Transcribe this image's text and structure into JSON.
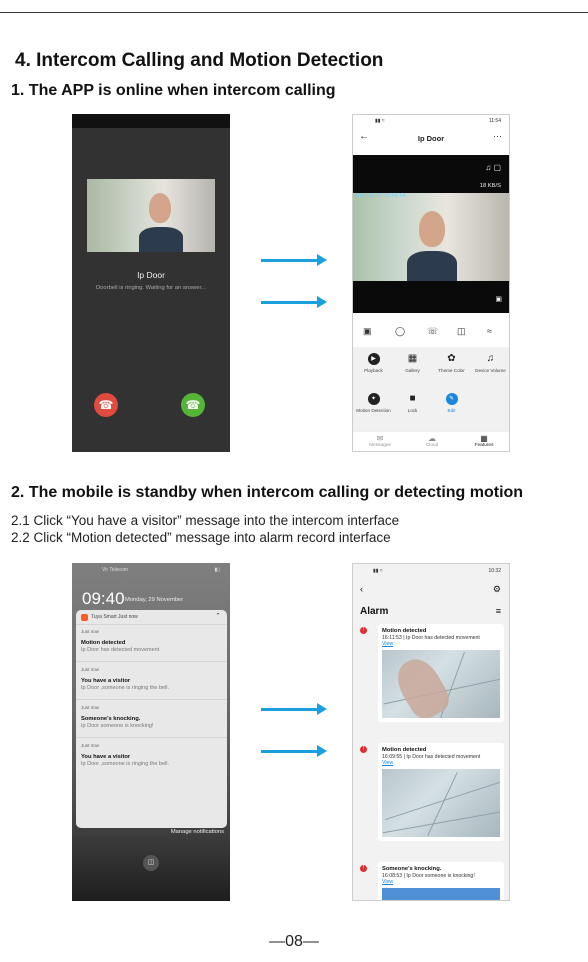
{
  "section_title": "4. Intercom Calling and Motion Detection",
  "sub1": "1. The APP is online when intercom calling",
  "sub2": "2. The mobile is standby when intercom calling or detecting motion",
  "step1": "2.1 Click “You have a visitor” message into the intercom interface",
  "step2": "2.2 Click “Motion detected” message into alarm record interface",
  "page_number": "—08—",
  "accent_color": "#1aa0dd",
  "call_screen": {
    "device_name": "Ip Door",
    "status": "Doorbell is ringing. Waiting for an answer..."
  },
  "live_view": {
    "status_time": "11:54",
    "title": "Ip Door",
    "more": "···",
    "rate": "18 KB/S",
    "timestamp": "2021-11-27 11:54:14",
    "features": [
      {
        "label": "Playback",
        "icon": "play-icon"
      },
      {
        "label": "Gallery",
        "icon": "gallery-icon"
      },
      {
        "label": "Theme Color",
        "icon": "palette-icon"
      },
      {
        "label": "Device Volume",
        "icon": "speaker-icon"
      },
      {
        "label": "Motion Detection",
        "icon": "motion-icon"
      },
      {
        "label": "Lock",
        "icon": "lock-icon"
      },
      {
        "label": "Edit",
        "icon": "edit-icon"
      }
    ],
    "tabs": [
      "Messages",
      "Cloud",
      "Features"
    ]
  },
  "lock_screen": {
    "carrier": "Vir Telecom",
    "time": "09:40",
    "date": "Monday, 29 November",
    "app": "Tuya Smart",
    "app_time": "Just now",
    "notifications": [
      {
        "time": "Just now",
        "title": "Motion detected",
        "body": "Ip Door has detected movement"
      },
      {
        "time": "Just now",
        "title": "You have a visitor",
        "body": "Ip Door ,someone is ringing the bell."
      },
      {
        "time": "Just now",
        "title": "Someone's knocking.",
        "body": "Ip Door someone is knocking!"
      },
      {
        "time": "Just now",
        "title": "You have a visitor",
        "body": "Ip Door ,someone is ringing the bell."
      }
    ],
    "manage": "Manage notifications"
  },
  "alarm_screen": {
    "status_time": "10:32",
    "title": "Alarm",
    "view_label": "View",
    "records": [
      {
        "title": "Motion detected",
        "sub": "16:11:53 | Ip Door has detected movement"
      },
      {
        "title": "Motion detected",
        "sub": "16:09:55 | Ip Door has detected movement"
      },
      {
        "title": "Someone's knocking.",
        "sub": "16:08:53 | Ip Door someone is knocking!"
      }
    ]
  }
}
